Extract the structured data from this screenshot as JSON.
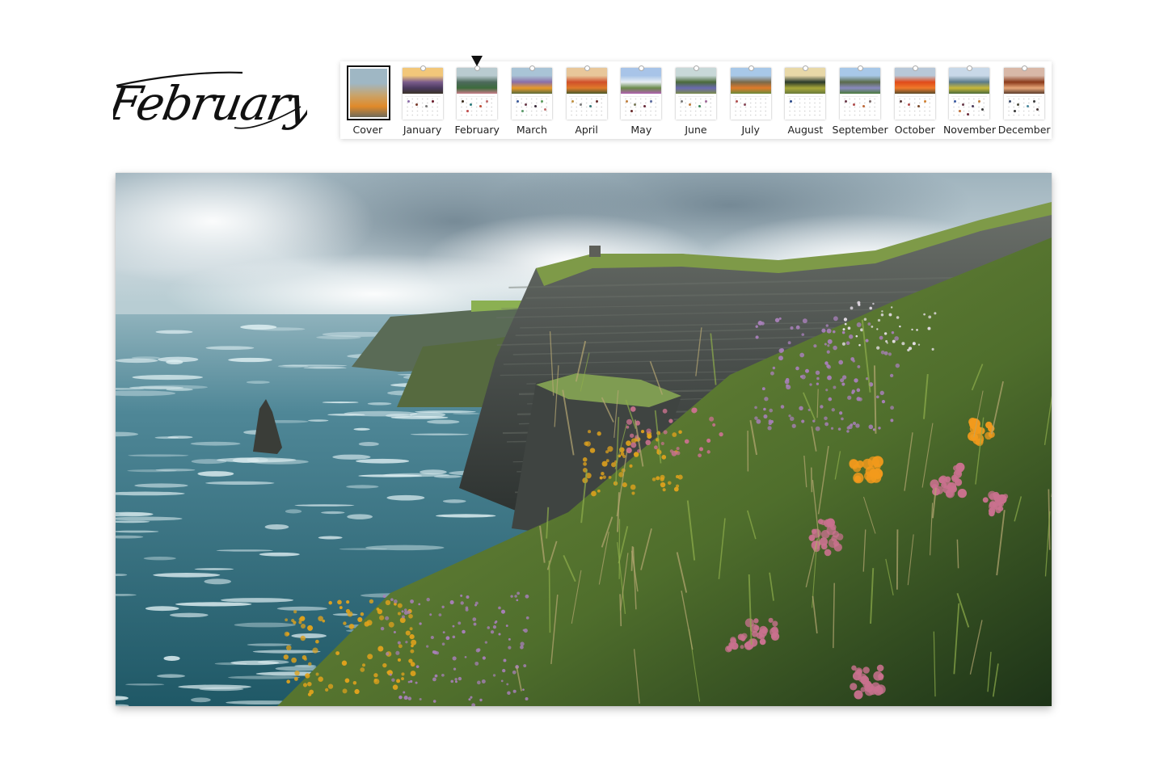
{
  "title": {
    "current_month": "February"
  },
  "strip": {
    "selected_index": 2,
    "items": [
      {
        "label": "Cover",
        "kind": "cover",
        "photo_colors": [
          "#9fb7c4",
          "#c9a36a",
          "#e08a2a",
          "#6f6a5a"
        ],
        "dots": []
      },
      {
        "label": "January",
        "kind": "month",
        "photo_colors": [
          "#f2c77a",
          "#7a5c8c",
          "#4a3a5e",
          "#3b3328"
        ],
        "dots": [
          "#8a6ba8",
          "#7a3a2a",
          "#777777",
          "#6a1a2a"
        ]
      },
      {
        "label": "February",
        "kind": "month",
        "photo_colors": [
          "#b9cbd0",
          "#4d6a5c",
          "#3c6b3c",
          "#c97d8a"
        ],
        "dots": [
          "#3a2a1a",
          "#2a7a7a",
          "#c0503a",
          "#c06a6a",
          "#c04a4a"
        ]
      },
      {
        "label": "March",
        "kind": "month",
        "photo_colors": [
          "#a9c4d6",
          "#8a6ea8",
          "#e89a2a",
          "#5a6a3a"
        ],
        "dots": [
          "#3a5a9a",
          "#6a3a4a",
          "#3a2a3a",
          "#5a9a5a",
          "#5a9a6a",
          "#c07070"
        ]
      },
      {
        "label": "April",
        "kind": "month",
        "photo_colors": [
          "#e8c79a",
          "#d0502a",
          "#e07a2a",
          "#4a5a2a"
        ],
        "dots": [
          "#c09040",
          "#7a7a7a",
          "#3a7a7a",
          "#6a2a2a"
        ]
      },
      {
        "label": "May",
        "kind": "month",
        "photo_colors": [
          "#a8c4e8",
          "#e8eef4",
          "#6a8a4a",
          "#b060b0"
        ],
        "dots": [
          "#c08040",
          "#7a7a5a",
          "#6a2a3a",
          "#5a6aa0",
          "#6a2a2a"
        ]
      },
      {
        "label": "June",
        "kind": "month",
        "photo_colors": [
          "#c8d8d8",
          "#4a6a3a",
          "#6a6ab0",
          "#7a8a4a"
        ],
        "dots": [
          "#7a7a7a",
          "#c07a3a",
          "#3a8a5a",
          "#a06a9a"
        ]
      },
      {
        "label": "July",
        "kind": "month",
        "photo_colors": [
          "#a8c8e8",
          "#7a6a4a",
          "#e07a2a",
          "#6a8a3a"
        ],
        "dots": [
          "#b05050",
          "#8a4a5a"
        ]
      },
      {
        "label": "August",
        "kind": "month",
        "photo_colors": [
          "#e8d8a8",
          "#2a3a2a",
          "#a8a83a",
          "#6a7a3a"
        ],
        "dots": [
          "#2a4a8a"
        ]
      },
      {
        "label": "September",
        "kind": "month",
        "photo_colors": [
          "#a8c8e8",
          "#5a6a4a",
          "#8a8ac0",
          "#4a7a3a"
        ],
        "dots": [
          "#6a3a4a",
          "#b04a4a",
          "#c06a3a",
          "#7a6a6a"
        ]
      },
      {
        "label": "October",
        "kind": "month",
        "photo_colors": [
          "#b8c8d8",
          "#e04a1a",
          "#f07a2a",
          "#5a4a2a"
        ],
        "dots": [
          "#5a3a3a",
          "#b04a4a",
          "#7a4a2a",
          "#d08030"
        ]
      },
      {
        "label": "November",
        "kind": "month",
        "photo_colors": [
          "#c8d8e8",
          "#5a7a8a",
          "#c8b83a",
          "#4a6a3a"
        ],
        "dots": [
          "#3a5aa0",
          "#6a3a4a",
          "#4a3a5a",
          "#c08040",
          "#c0703a",
          "#3a3a3a",
          "#6a2a3a"
        ]
      },
      {
        "label": "December",
        "kind": "month",
        "photo_colors": [
          "#d8b8a8",
          "#8a3a1a",
          "#e8a87a",
          "#5a3a2a"
        ],
        "dots": [
          "#3a4a6a",
          "#4a4a3a",
          "#4a8aa0",
          "#3a3a3a",
          "#3a3a3a",
          "#4a3a3a"
        ]
      }
    ]
  },
  "hero": {
    "alt": "Sea cliffs with wildflowers over a turbulent ocean under cloudy sky",
    "palette": {
      "sky": "#c9d6dc",
      "cloud": "#eef2f3",
      "cloud_shadow": "#8c9ea6",
      "sea": "#3b7384",
      "foam": "#dfeff2",
      "cliff": "#4a4e4c",
      "cliff_light": "#6c726b",
      "grass": "#6d8a3c",
      "gorse": "#e0a21c",
      "heather": "#a77fb8",
      "thrift": "#c9718e",
      "poppy": "#f29a1c"
    }
  }
}
